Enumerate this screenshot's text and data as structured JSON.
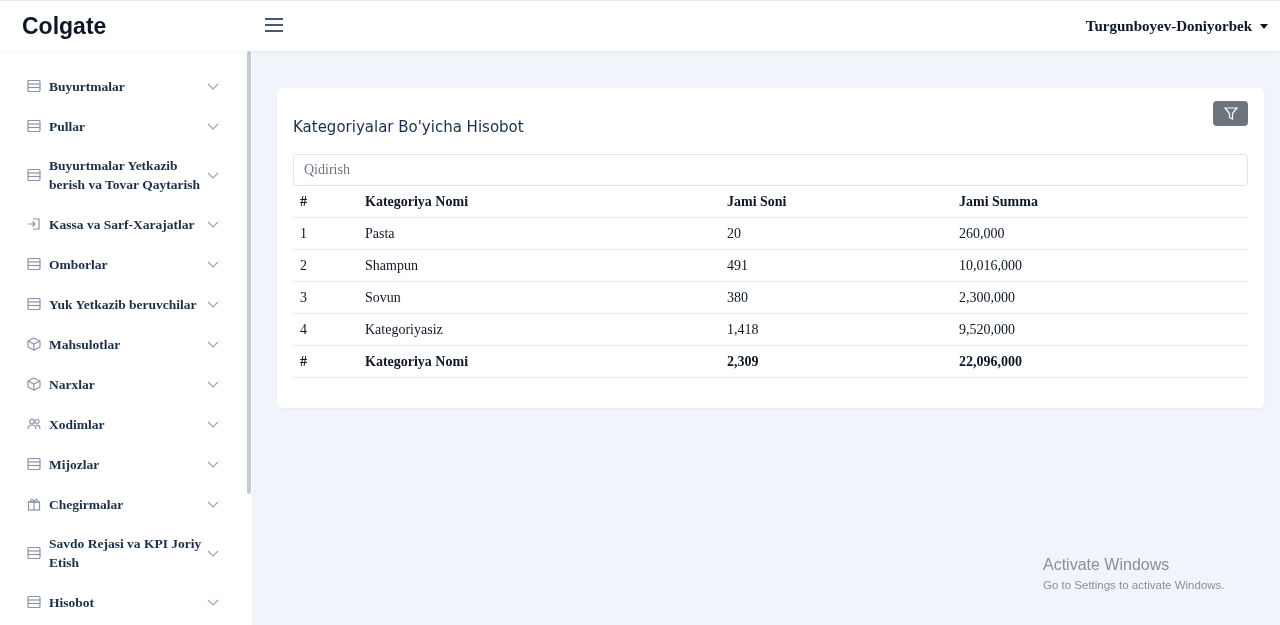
{
  "header": {
    "logo": "Colgate",
    "user": "Turgunboyev-Doniyorbek"
  },
  "sidebar": {
    "items": [
      {
        "label": "Buyurtmalar",
        "kind": "list",
        "expanded": false
      },
      {
        "label": "Pullar",
        "kind": "list",
        "expanded": false
      },
      {
        "label": "Buyurtmalar Yetkazib berish va Tovar Qaytarish",
        "kind": "list",
        "expanded": false
      },
      {
        "label": "Kassa va Sarf-Xarajatlar",
        "kind": "enter",
        "expanded": false
      },
      {
        "label": "Omborlar",
        "kind": "list",
        "expanded": false
      },
      {
        "label": "Yuk Yetkazib beruvchilar",
        "kind": "list",
        "expanded": false
      },
      {
        "label": "Mahsulotlar",
        "kind": "box",
        "expanded": false
      },
      {
        "label": "Narxlar",
        "kind": "box",
        "expanded": false
      },
      {
        "label": "Xodimlar",
        "kind": "users",
        "expanded": false
      },
      {
        "label": "Mijozlar",
        "kind": "list",
        "expanded": false
      },
      {
        "label": "Chegirmalar",
        "kind": "gift",
        "expanded": false
      },
      {
        "label": "Savdo Rejasi va KPI Joriy Etish",
        "kind": "list",
        "expanded": false
      },
      {
        "label": "Hisobot",
        "kind": "list",
        "expanded": false
      }
    ]
  },
  "report": {
    "title": "Kategoriyalar Bo'yicha Hisobot",
    "search": {
      "placeholder": "Qidirish"
    },
    "table": {
      "columns": [
        "#",
        "Kategoriya Nomi",
        "Jami Soni",
        "Jami Summa"
      ],
      "rows": [
        [
          "1",
          "Pasta",
          "20",
          "260,000"
        ],
        [
          "2",
          "Shampun",
          "491",
          "10,016,000"
        ],
        [
          "3",
          "Sovun",
          "380",
          "2,300,000"
        ],
        [
          "4",
          "Kategoriyasiz",
          "1,418",
          "9,520,000"
        ]
      ],
      "footer": [
        "#",
        "Kategoriya Nomi",
        "2,309",
        "22,096,000"
      ]
    }
  },
  "os_overlay": {
    "title": "Activate Windows",
    "subtitle": "Go to Settings to activate Windows."
  }
}
